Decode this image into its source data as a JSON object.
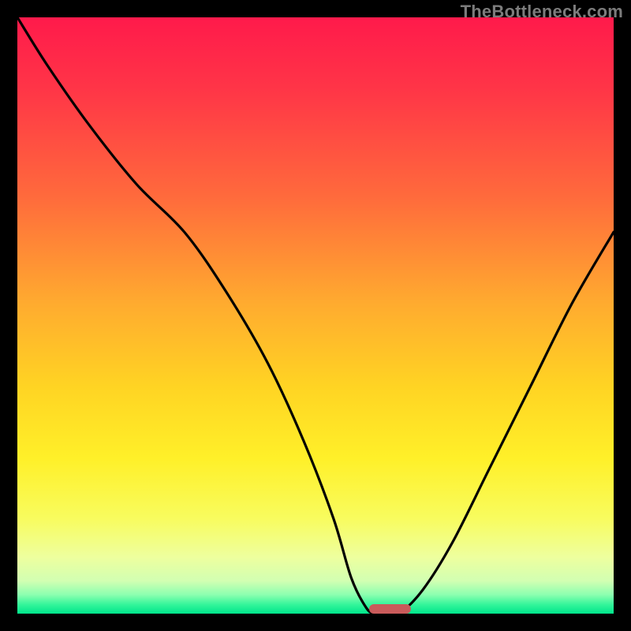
{
  "watermark": "TheBottleneck.com",
  "colors": {
    "frame": "#000000",
    "marker": "#c95b5b",
    "curve": "#000000",
    "gradient_stops": [
      {
        "offset": 0.0,
        "color": "#ff1a4b"
      },
      {
        "offset": 0.12,
        "color": "#ff3547"
      },
      {
        "offset": 0.3,
        "color": "#ff6a3c"
      },
      {
        "offset": 0.48,
        "color": "#ffab2f"
      },
      {
        "offset": 0.62,
        "color": "#ffd423"
      },
      {
        "offset": 0.74,
        "color": "#fff029"
      },
      {
        "offset": 0.84,
        "color": "#f8fc5e"
      },
      {
        "offset": 0.905,
        "color": "#eeff9e"
      },
      {
        "offset": 0.945,
        "color": "#d2ffb2"
      },
      {
        "offset": 0.968,
        "color": "#8dffb0"
      },
      {
        "offset": 0.985,
        "color": "#33f59a"
      },
      {
        "offset": 1.0,
        "color": "#00e58b"
      }
    ]
  },
  "chart_data": {
    "type": "line",
    "title": "",
    "xlabel": "",
    "ylabel": "",
    "xlim": [
      0,
      100
    ],
    "ylim": [
      0,
      100
    ],
    "grid": false,
    "legend": false,
    "series": [
      {
        "name": "bottleneck-curve",
        "x": [
          0,
          5,
          12,
          20,
          28,
          35,
          42,
          48,
          53,
          56,
          58.5,
          60,
          62,
          64,
          68,
          73,
          79,
          86,
          93,
          100
        ],
        "y": [
          100,
          92,
          82,
          72,
          64,
          54,
          42,
          29,
          16,
          6,
          1,
          0,
          0,
          0,
          4,
          12,
          24,
          38,
          52,
          64
        ]
      }
    ],
    "marker": {
      "x_start": 59,
      "x_end": 66,
      "y": 0
    }
  }
}
